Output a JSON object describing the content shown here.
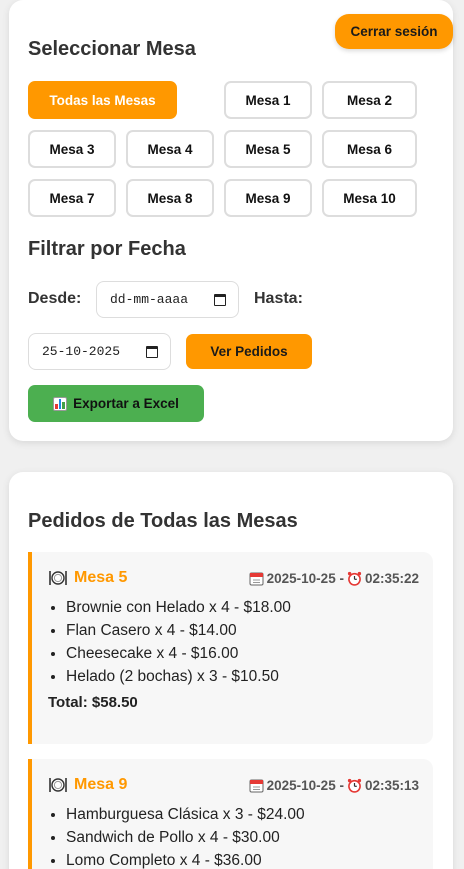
{
  "header": {
    "logout_label": "Cerrar sesión"
  },
  "mesa_section": {
    "title": "Seleccionar Mesa",
    "buttons": [
      {
        "label": "Todas las Mesas",
        "active": true
      },
      {
        "label": "Mesa 1"
      },
      {
        "label": "Mesa 2"
      },
      {
        "label": "Mesa 3"
      },
      {
        "label": "Mesa 4"
      },
      {
        "label": "Mesa 5"
      },
      {
        "label": "Mesa 6"
      },
      {
        "label": "Mesa 7"
      },
      {
        "label": "Mesa 8"
      },
      {
        "label": "Mesa 9"
      },
      {
        "label": "Mesa 10"
      }
    ]
  },
  "fecha_section": {
    "title": "Filtrar por Fecha",
    "desde_label": "Desde:",
    "desde_value": "dd-mm-aaaa",
    "hasta_label": "Hasta:",
    "hasta_value": "25-10-2025",
    "ver_pedidos_label": "Ver Pedidos",
    "export_label": "Exportar a Excel",
    "export_icon": "bar-chart-icon"
  },
  "orders_section": {
    "title": "Pedidos de Todas las Mesas",
    "orders": [
      {
        "mesa": "Mesa 5",
        "datetime": "2025-10-25 - ",
        "time": "02:35:22",
        "items": [
          "Brownie con Helado x 4 - $18.00",
          "Flan Casero x 4 - $14.00",
          "Cheesecake x 4 - $16.00",
          "Helado (2 bochas) x 3 - $10.50"
        ],
        "total": "Total: $58.50"
      },
      {
        "mesa": "Mesa 9",
        "datetime": "2025-10-25 - ",
        "time": "02:35:13",
        "items": [
          "Hamburguesa Clásica x 3 - $24.00",
          "Sandwich de Pollo x 4 - $30.00",
          "Lomo Completo x 4 - $36.00"
        ]
      }
    ]
  },
  "colors": {
    "accent": "#ff9800",
    "export": "#4caf50"
  }
}
